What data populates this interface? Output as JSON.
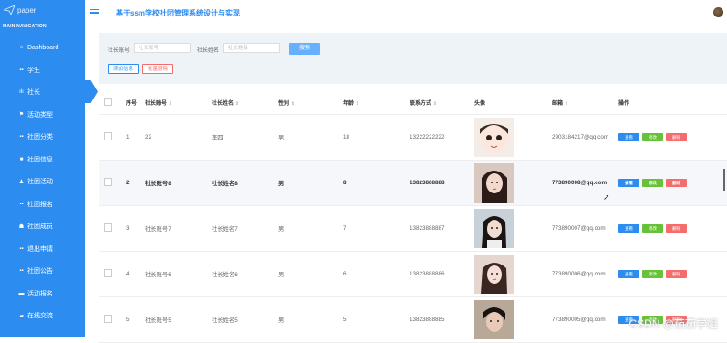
{
  "sidebar": {
    "logo": "paper",
    "nav_title": "MAIN NAVIGATION",
    "items": [
      {
        "icon": "⌂",
        "label": "Dashboard"
      },
      {
        "icon": "▪▪",
        "label": "学生"
      },
      {
        "icon": "ılı",
        "label": "社长"
      },
      {
        "icon": "⚑",
        "label": "活动类型"
      },
      {
        "icon": "▪▪",
        "label": "社团分类"
      },
      {
        "icon": "■",
        "label": "社团信息"
      },
      {
        "icon": "♟",
        "label": "社团活动"
      },
      {
        "icon": "▪▪",
        "label": "社团报名"
      },
      {
        "icon": "☗",
        "label": "社团成员"
      },
      {
        "icon": "▪▪",
        "label": "退出申请"
      },
      {
        "icon": "▪▪",
        "label": "社团公告"
      },
      {
        "icon": "▬",
        "label": "活动报名"
      },
      {
        "icon": "▰",
        "label": "在线交流"
      }
    ]
  },
  "header": {
    "title": "基于ssm学校社团管理系统设计与实现"
  },
  "search": {
    "label1": "社长账号",
    "placeholder1": "社长账号",
    "label2": "社长姓名",
    "placeholder2": "社长姓名",
    "search_label": "搜索",
    "add_label": "添加信息",
    "batch_delete_label": "批量删除"
  },
  "table": {
    "headers": [
      "序号",
      "社长账号",
      "社长姓名",
      "性别",
      "年龄",
      "联系方式",
      "头像",
      "邮箱",
      "操作"
    ],
    "sort_icon": "⇕",
    "actions": {
      "view": "查看",
      "edit": "修改",
      "delete": "删除"
    },
    "rows": [
      {
        "no": "1",
        "account": "22",
        "name": "李四",
        "gender": "男",
        "age": "18",
        "phone": "13222222222",
        "email": "2903184217@qq.com"
      },
      {
        "no": "2",
        "account": "社长账号8",
        "name": "社长姓名8",
        "gender": "男",
        "age": "8",
        "phone": "13823888888",
        "email": "773890008@qq.com"
      },
      {
        "no": "3",
        "account": "社长账号7",
        "name": "社长姓名7",
        "gender": "男",
        "age": "7",
        "phone": "13823888887",
        "email": "773890007@qq.com"
      },
      {
        "no": "4",
        "account": "社长账号6",
        "name": "社长姓名6",
        "gender": "男",
        "age": "6",
        "phone": "13823888886",
        "email": "773890006@qq.com"
      },
      {
        "no": "5",
        "account": "社长账号5",
        "name": "社长姓名5",
        "gender": "男",
        "age": "5",
        "phone": "13823888885",
        "email": "773890005@qq.com"
      }
    ]
  },
  "watermark": "CSDN @茄茄学姐"
}
